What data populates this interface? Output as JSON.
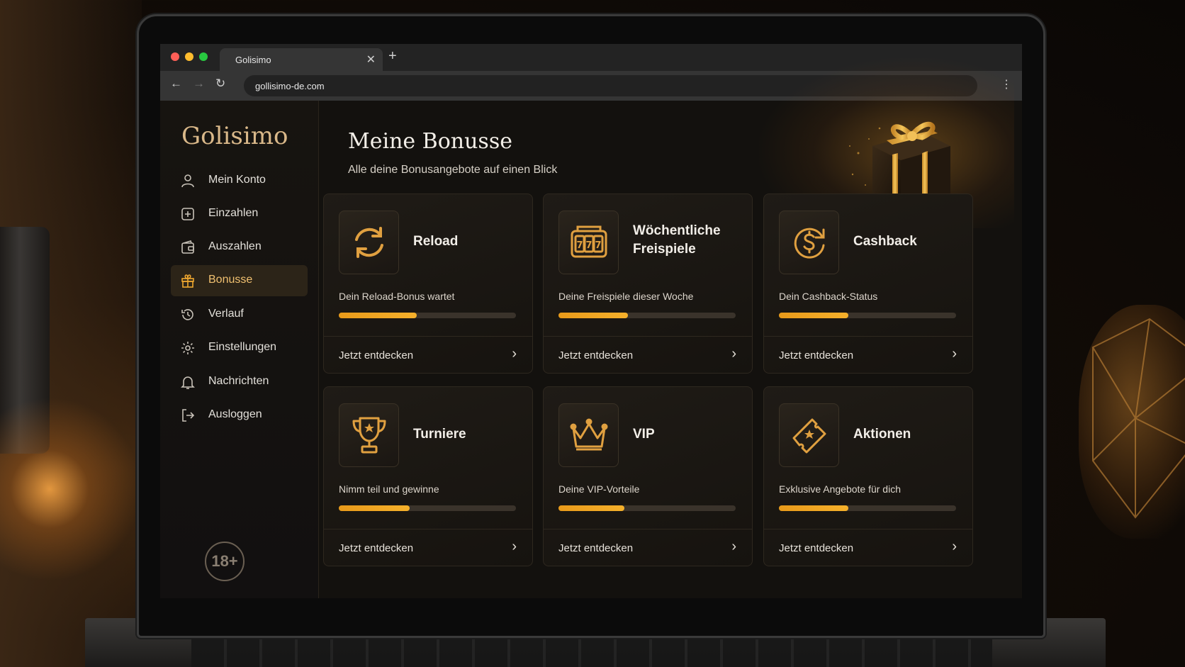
{
  "browser": {
    "tab_title": "Golisimo",
    "tab_close": "✕",
    "new_tab": "+",
    "url": "gollisimo-de.com",
    "back": "←",
    "forward": "→",
    "reload": "↻",
    "menu": "⋮"
  },
  "sidebar": {
    "brand": "Golisimo",
    "items": [
      {
        "label": "Mein Konto",
        "icon": "user-icon",
        "active": false
      },
      {
        "label": "Einzahlen",
        "icon": "deposit-icon",
        "active": false
      },
      {
        "label": "Auszahlen",
        "icon": "wallet-icon",
        "active": false
      },
      {
        "label": "Bonusse",
        "icon": "gift-icon",
        "active": true
      },
      {
        "label": "Verlauf",
        "icon": "history-icon",
        "active": false
      },
      {
        "label": "Einstellungen",
        "icon": "gear-icon",
        "active": false
      },
      {
        "label": "Nachrichten",
        "icon": "bell-icon",
        "active": false
      },
      {
        "label": "Ausloggen",
        "icon": "logout-icon",
        "active": false
      }
    ],
    "age_badge": "18+"
  },
  "main": {
    "title": "Meine Bonusse",
    "subtitle": "Alle deine Bonusangebote auf einen Blick",
    "cards": [
      {
        "title": "Reload",
        "title_line2": "",
        "icon": "reload-icon",
        "desc": "Dein Reload-Bonus wartet",
        "progress": 0.44,
        "link": "Jetzt entdecken"
      },
      {
        "title": "Wöchentliche",
        "title_line2": "Freispiele",
        "icon": "slot-machine-icon",
        "desc": "Deine Freispiele dieser Woche",
        "progress": 0.39,
        "link": "Jetzt entdecken"
      },
      {
        "title": "Cashback",
        "title_line2": "",
        "icon": "cashback-icon",
        "desc": "Dein Cashback-Status",
        "progress": 0.39,
        "link": "Jetzt entdecken"
      },
      {
        "title": "Turniere",
        "title_line2": "",
        "icon": "trophy-icon",
        "desc": "Nimm teil und gewinne",
        "progress": 0.4,
        "link": "Jetzt entdecken"
      },
      {
        "title": "VIP",
        "title_line2": "",
        "icon": "crown-icon",
        "desc": "Deine VIP-Vorteile",
        "progress": 0.37,
        "link": "Jetzt entdecken"
      },
      {
        "title": "Aktionen",
        "title_line2": "",
        "icon": "ticket-icon",
        "desc": "Exklusive Angebote für dich",
        "progress": 0.39,
        "link": "Jetzt entdecken"
      }
    ]
  },
  "colors": {
    "accent": "#f0a830",
    "active_bg": "#2c2418",
    "brand": "#d9b889"
  }
}
